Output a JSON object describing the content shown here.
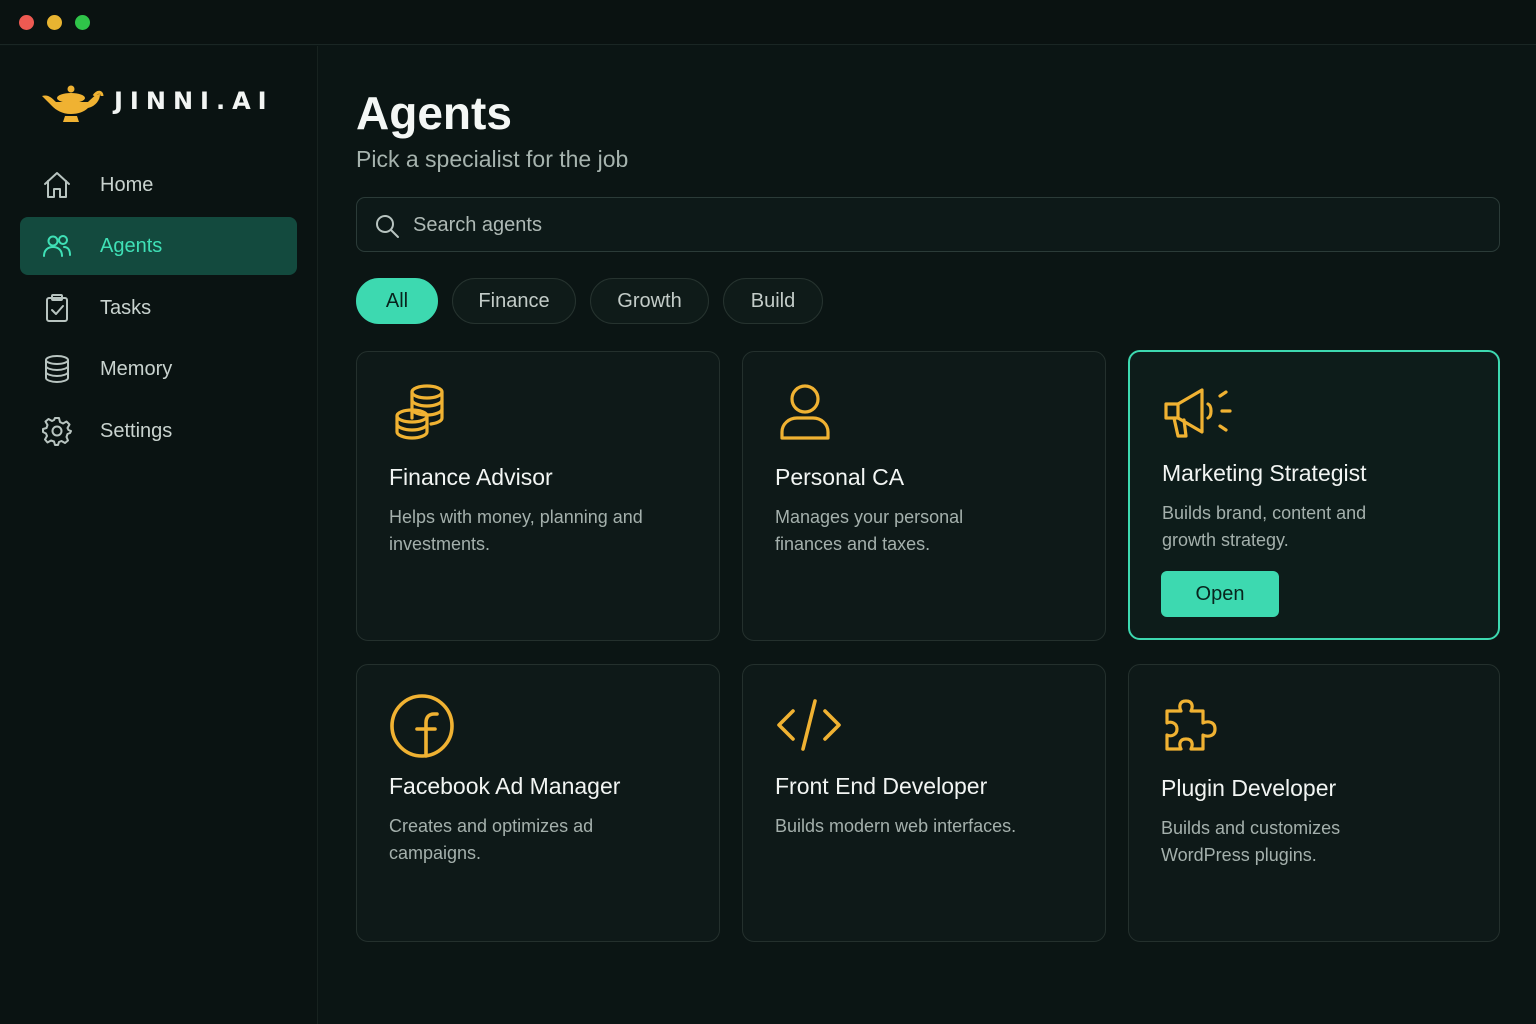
{
  "app": {
    "name": "JINNI.AI"
  },
  "colors": {
    "accent": "#3dd9b0",
    "icon_gold": "#f0b232",
    "background": "#0b1514"
  },
  "sidebar": {
    "items": [
      {
        "label": "Home",
        "icon": "home-icon",
        "active": false
      },
      {
        "label": "Agents",
        "icon": "users-icon",
        "active": true
      },
      {
        "label": "Tasks",
        "icon": "clipboard-check-icon",
        "active": false
      },
      {
        "label": "Memory",
        "icon": "database-icon",
        "active": false
      },
      {
        "label": "Settings",
        "icon": "gear-icon",
        "active": false
      }
    ]
  },
  "header": {
    "title": "Agents",
    "subtitle": "Pick a specialist for the job"
  },
  "search": {
    "placeholder": "Search agents",
    "value": ""
  },
  "filters": [
    {
      "label": "All",
      "active": true
    },
    {
      "label": "Finance",
      "active": false
    },
    {
      "label": "Growth",
      "active": false
    },
    {
      "label": "Build",
      "active": false
    }
  ],
  "agents": [
    {
      "title": "Finance Advisor",
      "description": "Helps with money, planning and investments.",
      "icon": "coins-icon"
    },
    {
      "title": "Personal CA",
      "description": "Manages your personal finances and taxes.",
      "icon": "user-icon"
    },
    {
      "title": "Marketing Strategist",
      "description": "Builds brand, content and growth strategy.",
      "icon": "megaphone-icon",
      "action_label": "Open",
      "selected": true
    },
    {
      "title": "Facebook Ad Manager",
      "description": "Creates and optimizes ad campaigns.",
      "icon": "facebook-icon"
    },
    {
      "title": "Front End Developer",
      "description": "Builds modern web interfaces.",
      "icon": "code-icon"
    },
    {
      "title": "Plugin Developer",
      "description": "Builds and customizes WordPress plugins.",
      "icon": "puzzle-icon"
    }
  ]
}
